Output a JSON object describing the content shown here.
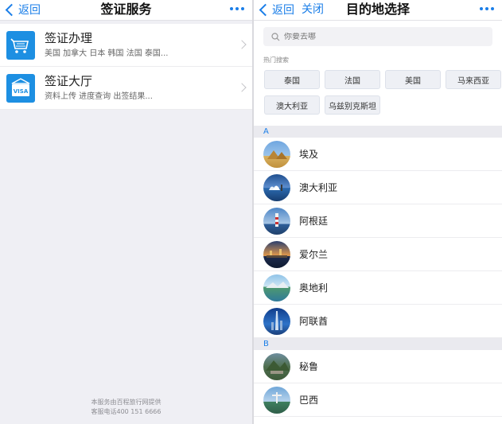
{
  "left": {
    "nav": {
      "back_label": "返回",
      "title": "签证服务"
    },
    "services": [
      {
        "title": "签证办理",
        "subtitle": "美国 加拿大 日本 韩国 法国 泰国...",
        "icon": "basket-icon"
      },
      {
        "title": "签证大厅",
        "subtitle": "资料上传 进度查询 出签结果...",
        "icon": "visa-card-icon"
      }
    ],
    "footer": {
      "line1": "本服务由百程旅行网提供",
      "line2": "客服电话400 151 6666"
    }
  },
  "right": {
    "nav": {
      "back_label": "返回",
      "close_label": "关闭",
      "title": "目的地选择"
    },
    "search": {
      "placeholder": "你要去哪"
    },
    "hot": {
      "label": "热门搜索",
      "items": [
        "泰国",
        "法国",
        "美国",
        "马来西亚",
        "澳大利亚",
        "乌兹别克斯坦"
      ]
    },
    "groups": [
      {
        "letter": "A",
        "items": [
          "埃及",
          "澳大利亚",
          "阿根廷",
          "爱尔兰",
          "奥地利",
          "阿联酋"
        ]
      },
      {
        "letter": "B",
        "items": [
          "秘鲁",
          "巴西"
        ]
      }
    ]
  },
  "colors": {
    "accent": "#1a7ee8",
    "icon_bg": "#1d8fe2",
    "page_bg": "#efeff4"
  }
}
